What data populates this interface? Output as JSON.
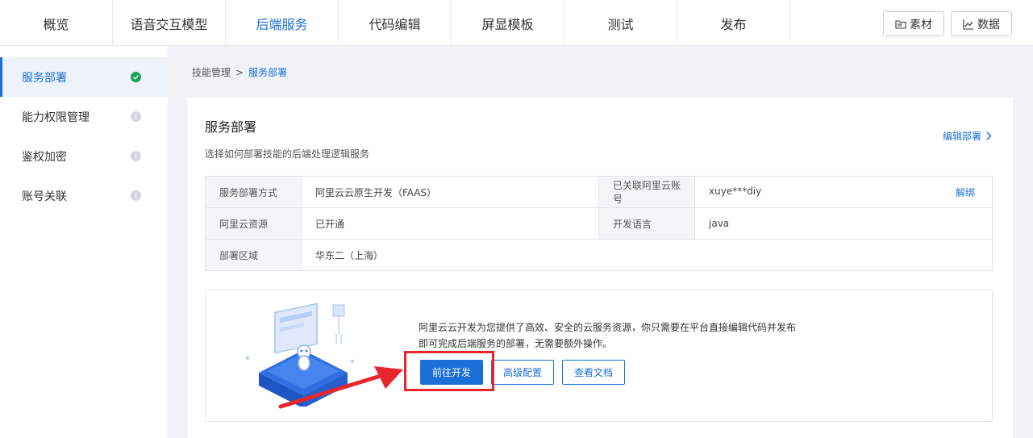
{
  "top_nav": {
    "tabs": [
      "概览",
      "语音交互模型",
      "后端服务",
      "代码编辑",
      "屏显模板",
      "测试",
      "发布"
    ],
    "active_index": 2,
    "right_buttons": [
      {
        "label": "素材",
        "icon": "folder-icon"
      },
      {
        "label": "数据",
        "icon": "chart-icon"
      }
    ]
  },
  "sidebar": {
    "items": [
      {
        "label": "服务部署",
        "status": "ok"
      },
      {
        "label": "能力权限管理",
        "status": "pending"
      },
      {
        "label": "鉴权加密",
        "status": "pending"
      },
      {
        "label": "账号关联",
        "status": "pending"
      }
    ]
  },
  "breadcrumb": {
    "root": "技能管理",
    "separator": ">",
    "current": "服务部署"
  },
  "panel": {
    "title": "服务部署",
    "description": "选择如何部署技能的后端处理逻辑服务",
    "edit_link": "编辑部署",
    "table": {
      "deploy_method_label": "服务部署方式",
      "deploy_method_value": "阿里云云原生开发（FAAS）",
      "linked_account_label": "已关联阿里云账号",
      "linked_account_value": "xuye***diy",
      "unbind_label": "解绑",
      "resource_label": "阿里云资源",
      "resource_value": "已开通",
      "language_label": "开发语言",
      "language_value": "java",
      "region_label": "部署区域",
      "region_value": "华东二（上海）"
    },
    "promo": {
      "text": "阿里云云开发为您提供了高效、安全的云服务资源，你只需要在平台直接编辑代码并发布即可完成后端服务的部署，无需要额外操作。",
      "buttons": {
        "go_dev": "前往开发",
        "advanced": "高级配置",
        "docs": "查看文档"
      }
    }
  },
  "colors": {
    "accent": "#1a6fd8",
    "success": "#1a9f53",
    "annotation": "#e8262b"
  }
}
